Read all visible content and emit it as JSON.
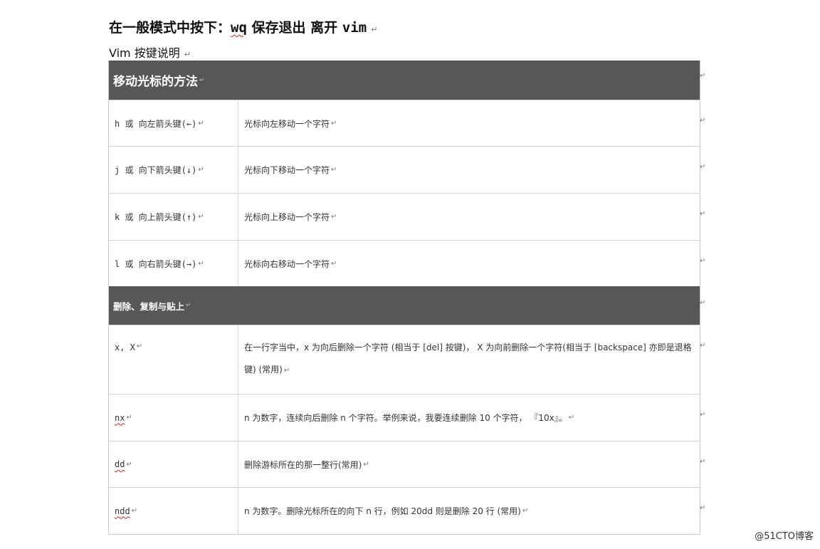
{
  "heading": {
    "prefix": "在一般模式中按下：",
    "wq": "wq",
    "middle": " 保存退出 离开 ",
    "vim": "vim",
    "para_mark": "↵"
  },
  "subheading": "Vim 按键说明",
  "table": {
    "sections": [
      {
        "title": "移动光标的方法",
        "rows": [
          {
            "key": "h 或 向左箭头键(←)",
            "desc": "光标向左移动一个字符"
          },
          {
            "key": "j 或 向下箭头键(↓)",
            "desc": "光标向下移动一个字符"
          },
          {
            "key": "k 或 向上箭头键(↑)",
            "desc": "光标向上移动一个字符"
          },
          {
            "key": "l 或 向右箭头键(→)",
            "desc": "光标向右移动一个字符"
          }
        ]
      },
      {
        "title": "删除、复制与贴上",
        "rows": [
          {
            "key": "x, X",
            "desc": "在一行字当中，x 为向后删除一个字符 (相当于 [del] 按键)， X 为向前删除一个字符(相当于 [backspace] 亦即是退格键) (常用)"
          },
          {
            "key": "nx",
            "desc": "n 为数字，连续向后删除 n 个字符。举例来说，我要连续删除 10 个字符， 『10x』。"
          },
          {
            "key": "dd",
            "desc": "删除游标所在的那一整行(常用)"
          },
          {
            "key": "ndd",
            "desc": "n 为数字。删除光标所在的向下 n 行，例如 20dd 则是删除 20 行 (常用)"
          }
        ]
      }
    ],
    "para_mark": "↵"
  },
  "watermark": "@51CTO博客"
}
